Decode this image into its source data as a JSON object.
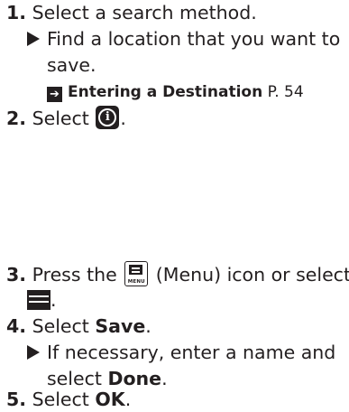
{
  "steps": [
    {
      "number": "1.",
      "text": "Select a search method.",
      "sub": {
        "line1": "Find a location that you want to",
        "line2": "save."
      },
      "reference": {
        "title": "Entering a Destination",
        "page": "P. 54"
      }
    },
    {
      "number": "2.",
      "text_before": "Select",
      "icon": "info-icon",
      "text_after": "."
    },
    {
      "number": "3.",
      "text_before": "Press the",
      "icon": "menu-button-icon",
      "icon_label": "MENU",
      "text_after": "(Menu) icon or select",
      "line2_icon": "list-menu-icon",
      "line2_after": "."
    },
    {
      "number": "4.",
      "text_before": "Select",
      "emphasis": "Save",
      "text_after": ".",
      "sub": {
        "line1": "If necessary, enter a name and",
        "line2_before": "select",
        "line2_emphasis": "Done",
        "line2_after": "."
      }
    },
    {
      "number": "5.",
      "text_before": "Select",
      "emphasis": "OK",
      "text_after": "."
    }
  ]
}
